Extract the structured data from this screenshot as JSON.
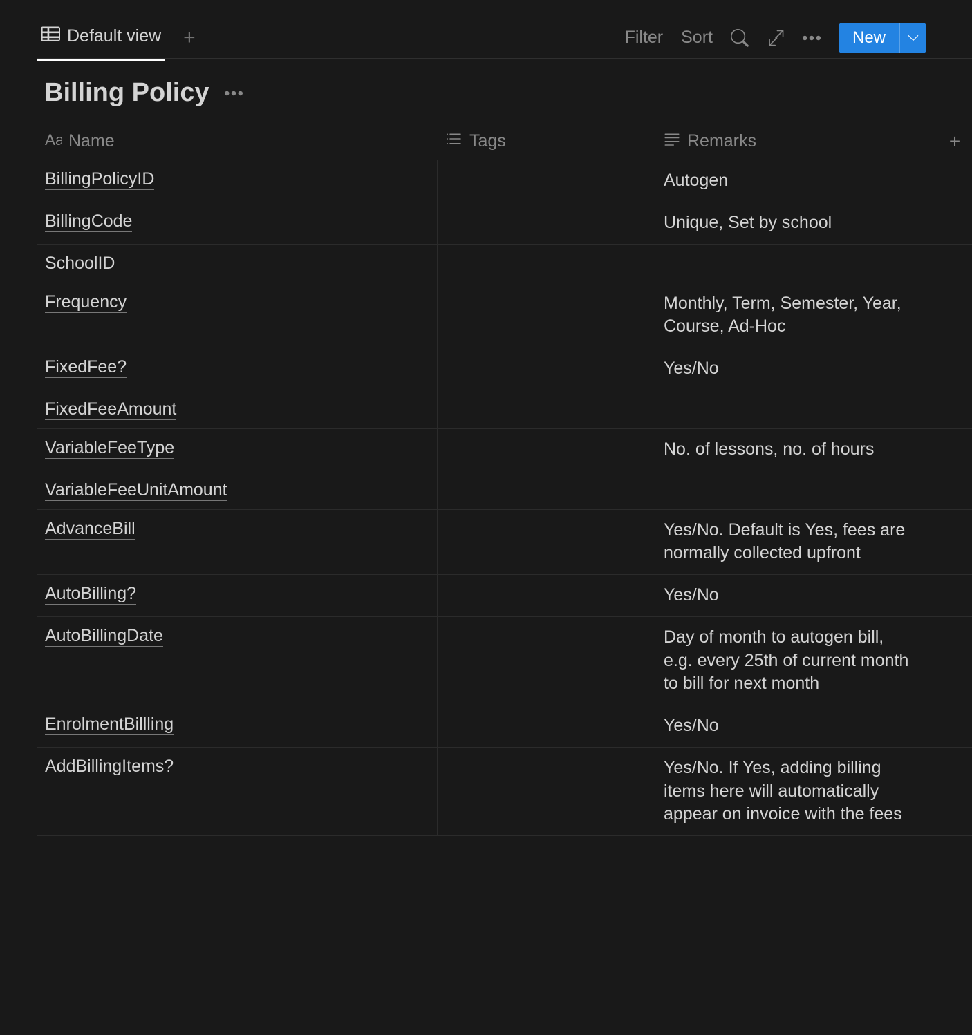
{
  "tabs": {
    "default_view": "Default view"
  },
  "toolbar": {
    "filter": "Filter",
    "sort": "Sort",
    "new": "New"
  },
  "database": {
    "title": "Billing Policy"
  },
  "columns": {
    "name": "Name",
    "tags": "Tags",
    "remarks": "Remarks"
  },
  "rows": [
    {
      "name": "BillingPolicyID",
      "tags": "",
      "remarks": "Autogen"
    },
    {
      "name": "BillingCode",
      "tags": "",
      "remarks": "Unique, Set by school"
    },
    {
      "name": "SchoolID",
      "tags": "",
      "remarks": ""
    },
    {
      "name": "Frequency",
      "tags": "",
      "remarks": "Monthly, Term, Semester, Year, Course, Ad-Hoc"
    },
    {
      "name": "FixedFee?",
      "tags": "",
      "remarks": "Yes/No"
    },
    {
      "name": "FixedFeeAmount",
      "tags": "",
      "remarks": ""
    },
    {
      "name": "VariableFeeType",
      "tags": "",
      "remarks": "No. of lessons, no. of hours"
    },
    {
      "name": "VariableFeeUnitAmount",
      "tags": "",
      "remarks": ""
    },
    {
      "name": "AdvanceBill",
      "tags": "",
      "remarks": "Yes/No. Default is Yes, fees are normally collected upfront"
    },
    {
      "name": "AutoBilling?",
      "tags": "",
      "remarks": "Yes/No"
    },
    {
      "name": "AutoBillingDate",
      "tags": "",
      "remarks": "Day of month to autogen bill, e.g. every 25th of current month to bill for next month"
    },
    {
      "name": "EnrolmentBillling",
      "tags": "",
      "remarks": "Yes/No"
    },
    {
      "name": "AddBillingItems?",
      "tags": "",
      "remarks": "Yes/No. If Yes, adding billing items here will automatically appear on invoice with the fees"
    }
  ]
}
